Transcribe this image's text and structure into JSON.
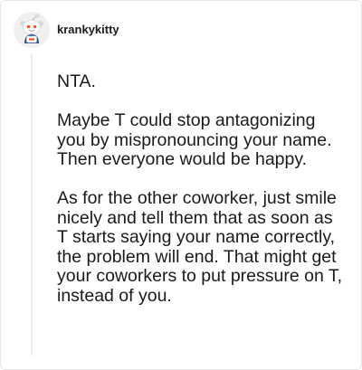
{
  "comment": {
    "author": "krankykitty",
    "avatar_icon": "reddit-snoo-avatar-icon",
    "paragraphs": [
      "NTA.",
      "Maybe T could stop antagonizing you by mispronouncing your name. Then everyone would be happy.",
      "As for the other coworker, just smile nicely and tell them that as soon as T starts saying your name correctly, the problem will end. That might get your coworkers to put pressure on T, instead of you."
    ]
  },
  "colors": {
    "text": "#1a1a1b",
    "thread_line": "#ededed",
    "avatar_bg": "#f0f0f0",
    "accent": "#ff4500"
  }
}
